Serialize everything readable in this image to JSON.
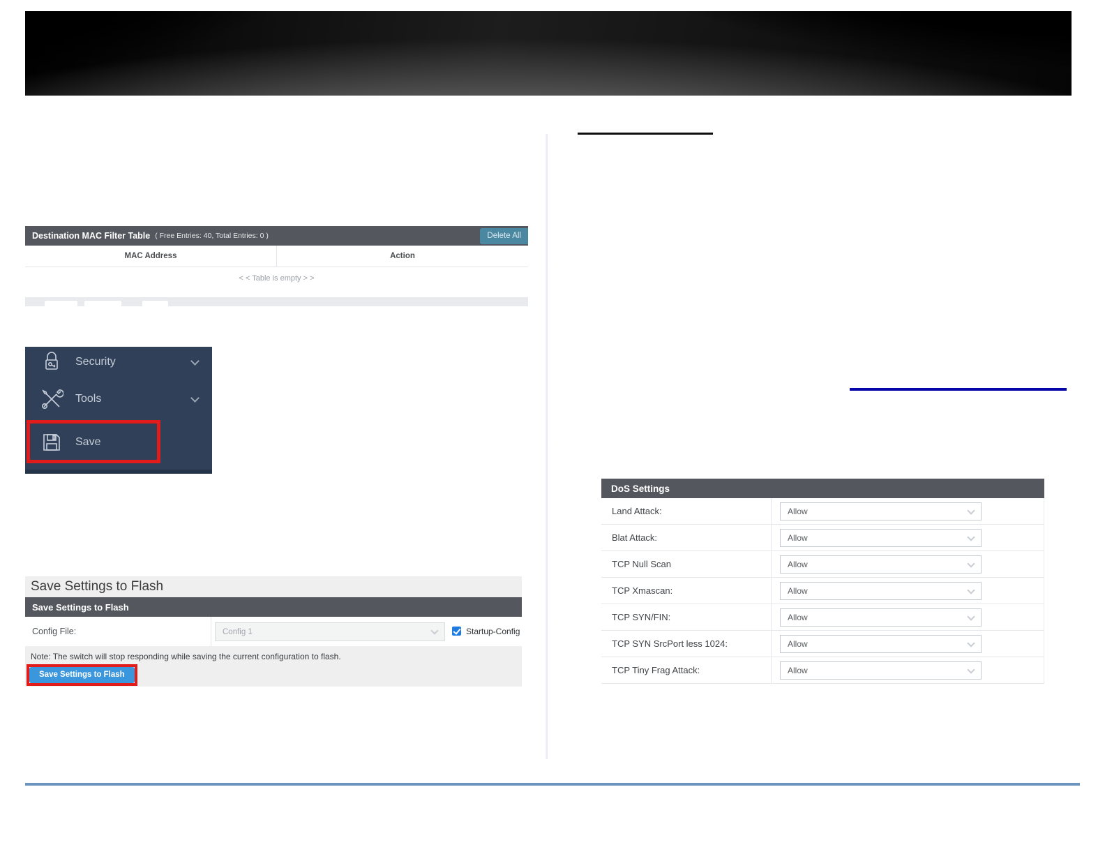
{
  "theme": {
    "colors": {
      "accent-red": "#e21b1b",
      "header-bar": "#54585e",
      "sidebar-bg": "#2f4058",
      "button-blue": "#3a96dd",
      "delete-teal": "#4a87a0",
      "checkbox-blue": "#1e7ce0",
      "rule-steel": "#6b95c0",
      "rule-navy": "#0505a8",
      "panel-gray": "#efefef"
    }
  },
  "mac_table": {
    "title": "Destination MAC Filter Table",
    "subtitle": "( Free Entries: 40, Total Entries: 0 )",
    "delete_all_label": "Delete All",
    "columns": [
      "MAC Address",
      "Action"
    ],
    "empty_text": "< < Table is empty > >"
  },
  "sidebar": {
    "items": [
      {
        "label": "Security",
        "icon": "lock-icon",
        "has_chevron": true
      },
      {
        "label": "Tools",
        "icon": "tools-icon",
        "has_chevron": true
      },
      {
        "label": "Save",
        "icon": "save-icon",
        "has_chevron": false,
        "highlighted": true
      }
    ]
  },
  "save_settings": {
    "page_title": "Save Settings to Flash",
    "panel_title": "Save Settings to Flash",
    "config_file_label": "Config File:",
    "config_file_value": "Config 1",
    "startup_config_label": "Startup-Config",
    "startup_config_checked": true,
    "note": "Note: The switch will stop responding while saving the current configuration to flash.",
    "button_label": "Save Settings to Flash"
  },
  "dos_settings": {
    "title": "DoS Settings",
    "rows": [
      {
        "label": "Land Attack:",
        "value": "Allow"
      },
      {
        "label": "Blat Attack:",
        "value": "Allow"
      },
      {
        "label": "TCP Null Scan",
        "value": "Allow"
      },
      {
        "label": "TCP Xmascan:",
        "value": "Allow"
      },
      {
        "label": "TCP SYN/FIN:",
        "value": "Allow"
      },
      {
        "label": "TCP SYN SrcPort less 1024:",
        "value": "Allow"
      },
      {
        "label": "TCP Tiny Frag Attack:",
        "value": "Allow"
      }
    ]
  }
}
